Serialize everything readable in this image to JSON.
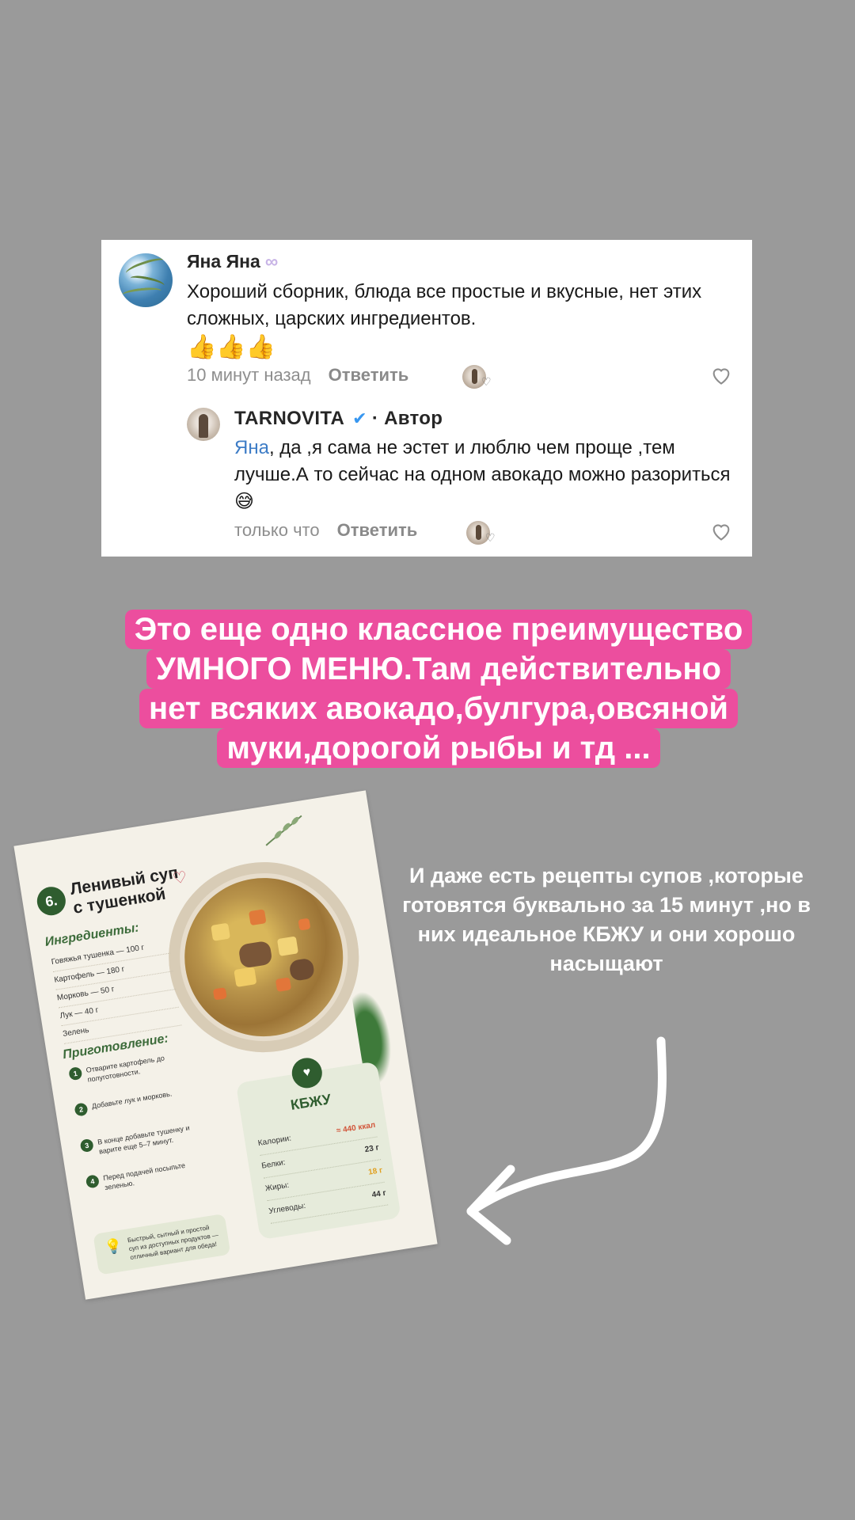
{
  "comment": {
    "author": "Яна Яна",
    "author_badge": "♾️",
    "text": "Хороший сборник, блюда все простые и вкусные, нет этих сложных, царских ингредиентов.",
    "emojis": "👍👍👍",
    "time": "10 минут назад",
    "reply_label": "Ответить"
  },
  "reply": {
    "author": "TARNOVITA",
    "verified_icon": "check-icon",
    "role": "· Автор",
    "mention": "Яна",
    "text": ", да ,я сама не эстет и люблю чем проще ,тем лучше.А то сейчас на одном авокадо можно разориться😅",
    "time": "только что",
    "reply_label": "Ответить"
  },
  "pink_caption": {
    "lines": [
      "Это еще одно классное преимущество",
      "УМНОГО МЕНЮ.Там действительно",
      "нет всяких авокадо,булгура,овсяной",
      "муки,дорогой рыбы и тд ..."
    ],
    "color": "#ec4e9e"
  },
  "side_caption": "И даже есть рецепты супов ,которые готовятся буквально за 15 минут ,но в них идеальное КБЖУ и они хорошо насыщают",
  "recipe": {
    "number": "6.",
    "title_line1": "Ленивый суп",
    "title_line2": "с тушенкой",
    "ingredients_title": "Ингредиенты:",
    "ingredients": [
      "Говяжья тушенка — 100 г",
      "Картофель — 180 г",
      "Морковь — 50 г",
      "Лук — 40 г",
      "Зелень"
    ],
    "prep_title": "Приготовление:",
    "steps": [
      "Отварите картофель до полуготовности.",
      "Добавьте лук и морковь.",
      "В конце добавьте тушенку и варите еще 5–7 минут.",
      "Перед подачей посыпьте зеленью."
    ],
    "tip": "Быстрый, сытный и простой суп из доступных продуктов — отличный вариант для обеда!",
    "kbju_title": "КБЖУ",
    "kbju": [
      {
        "label": "Калории:",
        "value": "≈ 440 ккал"
      },
      {
        "label": "Белки:",
        "value": "23 г"
      },
      {
        "label": "Жиры:",
        "value": "18 г"
      },
      {
        "label": "Углеводы:",
        "value": "44 г"
      }
    ]
  }
}
